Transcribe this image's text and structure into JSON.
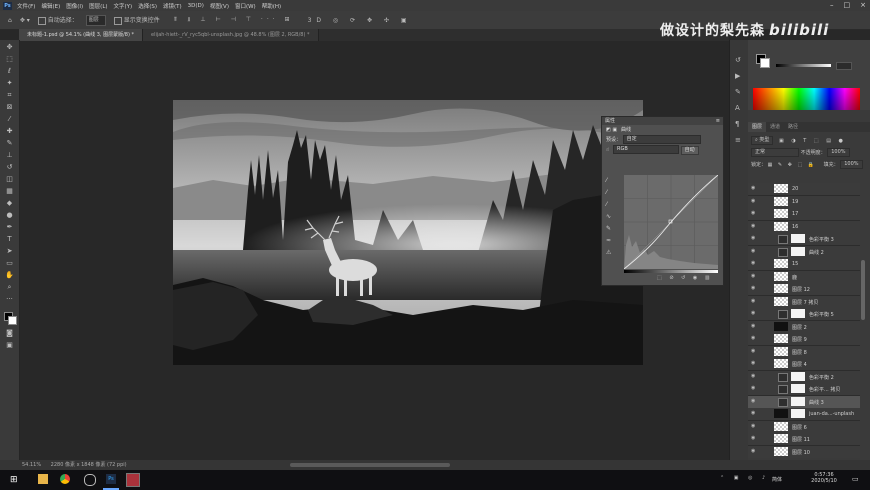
{
  "menubar": {
    "app_icon": "Ps",
    "items": [
      "文件(F)",
      "编辑(E)",
      "图像(I)",
      "图层(L)",
      "文字(Y)",
      "选择(S)",
      "滤镜(T)",
      "3D(D)",
      "视图(V)",
      "窗口(W)",
      "帮助(H)"
    ]
  },
  "options": {
    "auto_select": "自动选择：",
    "auto_select_value": "图层",
    "show_transform": "显示变换控件"
  },
  "tabs": [
    {
      "label": "未标题-1.psd @ 54.1% (曲线 3, 图层蒙版/8) *"
    },
    {
      "label": "elijah-hiett-_rV_ryc5qbl-unsplash.jpg @ 48.8% (图层 2, RGB/8) *"
    }
  ],
  "watermark": {
    "text": "做设计的梨先森",
    "brand": "bilibili"
  },
  "curves": {
    "header": "属性",
    "title": "曲线",
    "preset_label": "预设：",
    "preset_value": "自定",
    "channel_value": "RGB",
    "auto_label": "自动"
  },
  "layers_panel": {
    "tabs": [
      "图层",
      "通道",
      "路径"
    ],
    "filter": "类型",
    "blend_mode": "正常",
    "opacity_label": "不透明度：",
    "opacity_value": "100%",
    "lock_label": "锁定：",
    "fill_label": "填充：",
    "fill_value": "100%",
    "layers": [
      {
        "name": "20",
        "type": "pixel"
      },
      {
        "name": "19",
        "type": "pixel"
      },
      {
        "name": "17",
        "type": "pixel"
      },
      {
        "name": "16",
        "type": "pixel"
      },
      {
        "name": "色彩平衡 3",
        "type": "adjust"
      },
      {
        "name": "曲线 2",
        "type": "adjust"
      },
      {
        "name": "15",
        "type": "pixel"
      },
      {
        "name": "鹿",
        "type": "pixel"
      },
      {
        "name": "图层 12",
        "type": "pixel"
      },
      {
        "name": "图层 7 拷贝",
        "type": "pixel"
      },
      {
        "name": "色彩平衡 5",
        "type": "adjust"
      },
      {
        "name": "图层 2",
        "type": "dark"
      },
      {
        "name": "图层 9",
        "type": "pixel"
      },
      {
        "name": "图层 8",
        "type": "pixel"
      },
      {
        "name": "图层 4",
        "type": "pixel"
      },
      {
        "name": "色彩平衡 2",
        "type": "adjust"
      },
      {
        "name": "色彩平... 拷贝",
        "type": "adjust"
      },
      {
        "name": "曲线 3",
        "type": "adjust",
        "selected": true
      },
      {
        "name": "juan-da...-unplash",
        "type": "photo"
      },
      {
        "name": "图层 6",
        "type": "pixel"
      },
      {
        "name": "图层 11",
        "type": "pixel"
      },
      {
        "name": "图层 10",
        "type": "pixel"
      }
    ]
  },
  "status": {
    "zoom": "54.11%",
    "doc": "2280 像素 x 1848 像素 (72 ppi)"
  },
  "taskbar": {
    "time": "0:57:36",
    "date": "2020/5/10",
    "ime": "简体"
  },
  "colors": {
    "bg_dark": "#282828",
    "panel": "#3a3a3a",
    "photoshop_blue": "#31a8ff"
  }
}
